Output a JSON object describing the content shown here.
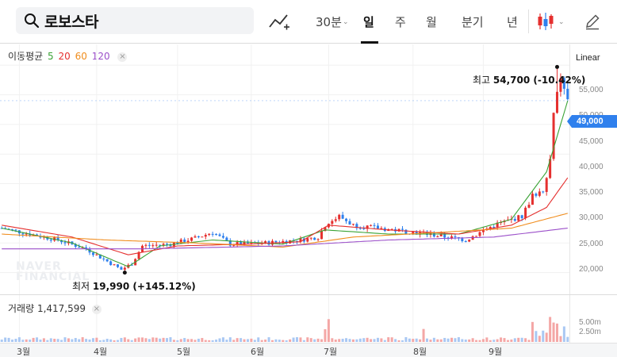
{
  "search": {
    "query": "로보스타"
  },
  "toolbar": {
    "interval_30m": "30분",
    "day": "일",
    "week": "주",
    "month": "월",
    "quarter": "분기",
    "year": "년",
    "active": "일"
  },
  "indicators": {
    "ma_label": "이동평균",
    "ma_periods": [
      "5",
      "20",
      "60",
      "120"
    ],
    "ma_colors": [
      "#3aa335",
      "#e5302f",
      "#f08c1c",
      "#9b4fc9"
    ]
  },
  "scale_mode": "Linear",
  "volume": {
    "label": "거래량",
    "value": "1,417,599"
  },
  "price": {
    "current": "49,000",
    "high_label": "최고",
    "high_value": "54,700 (-10.42%)",
    "low_label": "최저",
    "low_value": "19,990 (+145.12%)"
  },
  "colors": {
    "up": "#e5302f",
    "down": "#2f80ed",
    "accent": "#2f80ed"
  },
  "watermark": [
    "NAVER",
    "FINANCIAL"
  ],
  "chart_data": {
    "type": "candlestick",
    "y_ticks": [
      "55,000",
      "50,000",
      "45,000",
      "40,000",
      "35,000",
      "30,000",
      "25,000",
      "20,000"
    ],
    "y_tick_values": [
      55000,
      50000,
      45000,
      40000,
      35000,
      30000,
      25000,
      20000
    ],
    "ylim": [
      17000,
      58500
    ],
    "volume_ticks": [
      "5.00m",
      "2.50m"
    ],
    "volume_tick_values": [
      5000000,
      2500000
    ],
    "x_labels": [
      "3월",
      "4월",
      "5월",
      "6월",
      "7월",
      "8월",
      "9월"
    ],
    "x_label_day_index": [
      5,
      27,
      50,
      71,
      93,
      117,
      137
    ],
    "high": 54700,
    "low": 19990,
    "current": 49000,
    "ma_series": [
      {
        "name": "5",
        "anchors": [
          [
            0,
            27500
          ],
          [
            20,
            25000
          ],
          [
            36,
            21000
          ],
          [
            45,
            24500
          ],
          [
            60,
            25500
          ],
          [
            80,
            24800
          ],
          [
            92,
            27200
          ],
          [
            110,
            26500
          ],
          [
            130,
            26500
          ],
          [
            145,
            29000
          ],
          [
            155,
            37000
          ],
          [
            161,
            49000
          ]
        ]
      },
      {
        "name": "20",
        "anchors": [
          [
            0,
            28000
          ],
          [
            20,
            26000
          ],
          [
            36,
            23000
          ],
          [
            50,
            24500
          ],
          [
            70,
            24800
          ],
          [
            85,
            25200
          ],
          [
            93,
            28000
          ],
          [
            110,
            27200
          ],
          [
            130,
            26500
          ],
          [
            145,
            28000
          ],
          [
            155,
            31000
          ],
          [
            161,
            36000
          ]
        ]
      },
      {
        "name": "60",
        "anchors": [
          [
            0,
            26500
          ],
          [
            30,
            25500
          ],
          [
            55,
            25000
          ],
          [
            80,
            24300
          ],
          [
            100,
            26000
          ],
          [
            125,
            26800
          ],
          [
            145,
            27500
          ],
          [
            161,
            30000
          ]
        ]
      },
      {
        "name": "120",
        "anchors": [
          [
            0,
            24000
          ],
          [
            40,
            24000
          ],
          [
            80,
            24500
          ],
          [
            110,
            25500
          ],
          [
            140,
            26000
          ],
          [
            161,
            27500
          ]
        ]
      }
    ],
    "close_anchors": [
      [
        0,
        27500
      ],
      [
        8,
        26500
      ],
      [
        16,
        25500
      ],
      [
        24,
        24000
      ],
      [
        34,
        20500
      ],
      [
        37,
        21500
      ],
      [
        40,
        24500
      ],
      [
        48,
        24800
      ],
      [
        55,
        25800
      ],
      [
        60,
        26800
      ],
      [
        65,
        24800
      ],
      [
        75,
        25000
      ],
      [
        85,
        25500
      ],
      [
        90,
        26000
      ],
      [
        92,
        28000
      ],
      [
        96,
        29500
      ],
      [
        100,
        28000
      ],
      [
        110,
        27300
      ],
      [
        120,
        26600
      ],
      [
        132,
        25500
      ],
      [
        140,
        28000
      ],
      [
        148,
        29500
      ],
      [
        151,
        33000
      ],
      [
        154,
        34000
      ],
      [
        156,
        39000
      ],
      [
        158,
        54000
      ],
      [
        161,
        49000
      ]
    ]
  }
}
